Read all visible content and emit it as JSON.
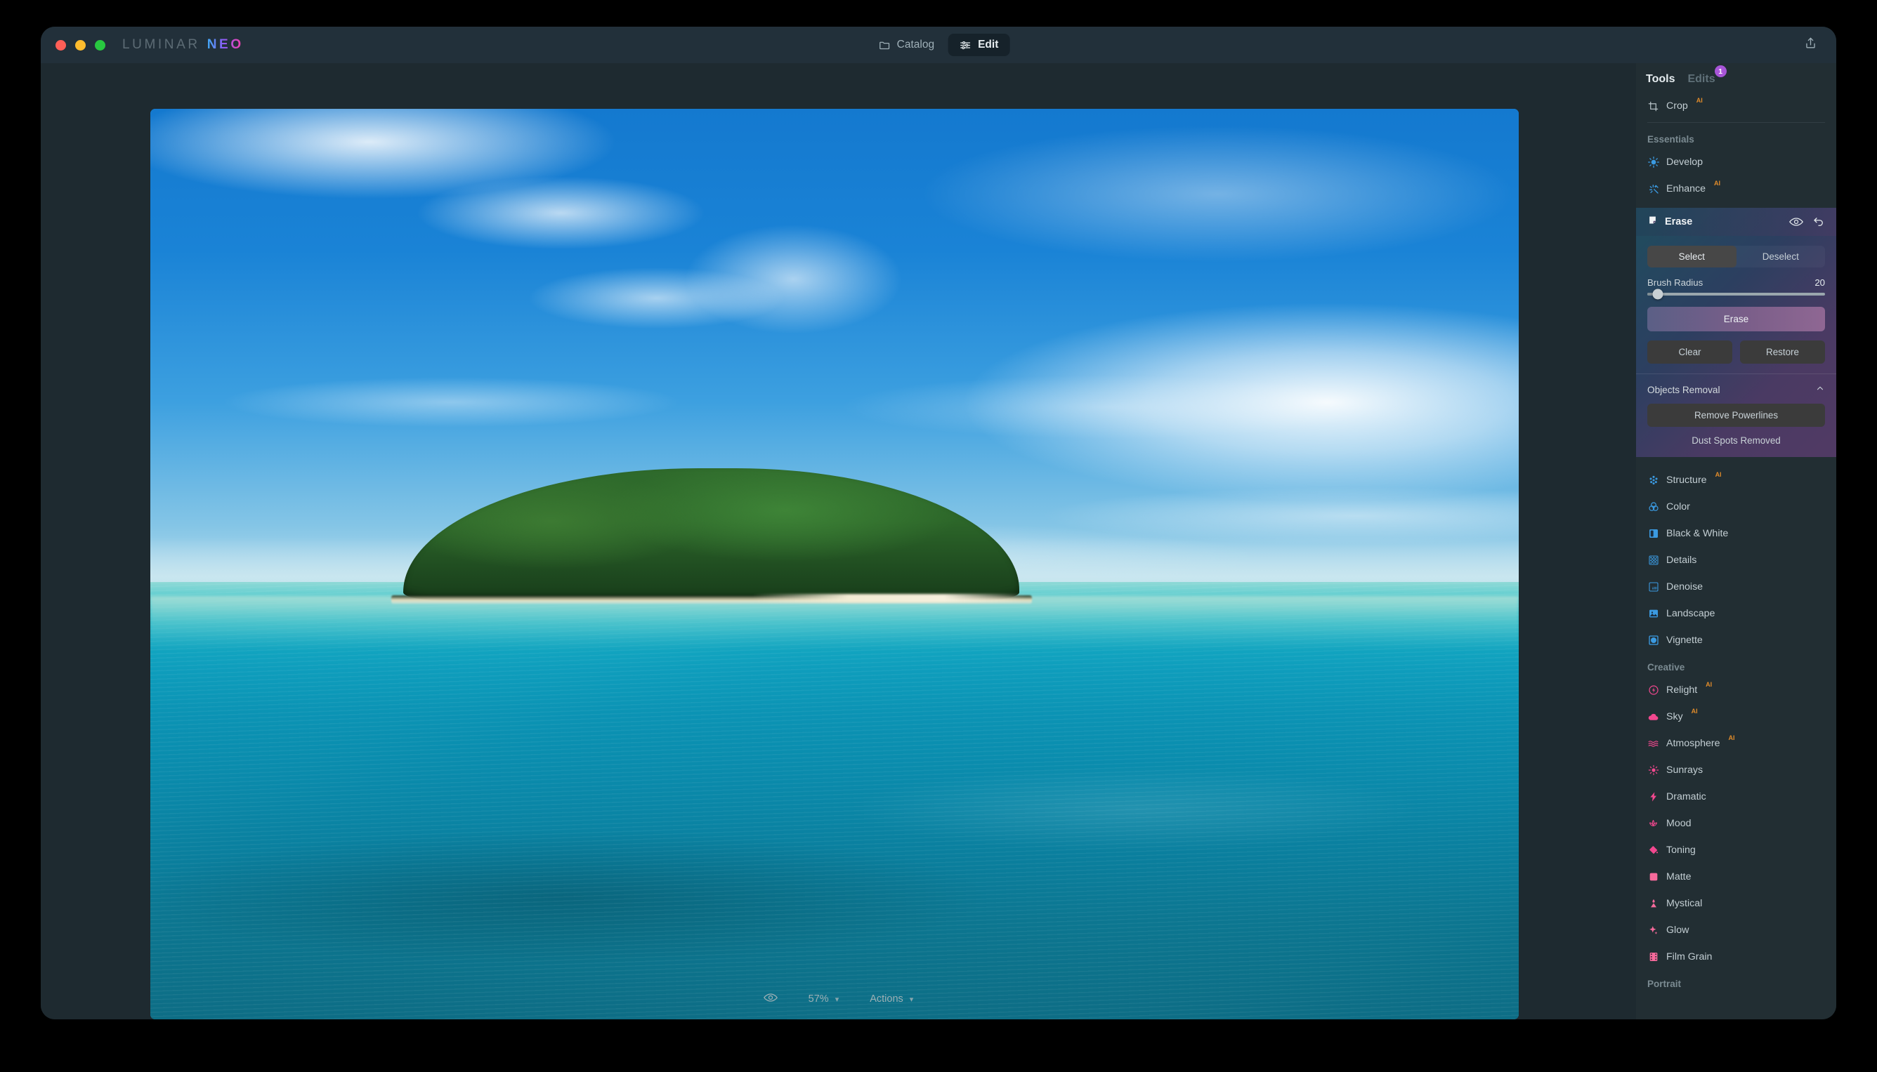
{
  "app": {
    "brand_primary": "LUMINAR",
    "brand_accent": "NEO",
    "accent_colors": {
      "purple": "#a855d8",
      "ai_orange": "#e08b2a",
      "blue_icon": "#3b9ae1",
      "pink_icon": "#f2488f"
    }
  },
  "titlebar": {
    "catalog_label": "Catalog",
    "edit_label": "Edit",
    "share_icon": "share-upload-icon"
  },
  "canvas": {
    "zoom_level": "57%",
    "actions_label": "Actions",
    "preview_icon": "eye-icon",
    "photo_alt": "tropical island with turquoise sea and blue sky"
  },
  "panel": {
    "tabs": {
      "tools": "Tools",
      "edits": "Edits",
      "edits_badge": "1"
    },
    "crop": {
      "label": "Crop",
      "ai": "AI"
    },
    "sections": {
      "essentials": "Essentials",
      "creative": "Creative",
      "portrait": "Portrait"
    },
    "essentials_items": [
      {
        "label": "Develop",
        "ai": "",
        "icon": "develop-sun-icon"
      },
      {
        "label": "Enhance",
        "ai": "AI",
        "icon": "enhance-sparkle-icon"
      }
    ],
    "after_erase_items": [
      {
        "label": "Structure",
        "ai": "AI",
        "icon": "structure-dots-icon"
      },
      {
        "label": "Color",
        "ai": "",
        "icon": "color-circles-icon"
      },
      {
        "label": "Black & White",
        "ai": "",
        "icon": "black-white-icon"
      },
      {
        "label": "Details",
        "ai": "",
        "icon": "details-grid-icon"
      },
      {
        "label": "Denoise",
        "ai": "",
        "icon": "denoise-icon"
      },
      {
        "label": "Landscape",
        "ai": "",
        "icon": "landscape-photo-icon"
      },
      {
        "label": "Vignette",
        "ai": "",
        "icon": "vignette-icon"
      }
    ],
    "creative_items": [
      {
        "label": "Relight",
        "ai": "AI",
        "icon": "relight-bolt-icon"
      },
      {
        "label": "Sky",
        "ai": "AI",
        "icon": "sky-cloud-icon"
      },
      {
        "label": "Atmosphere",
        "ai": "AI",
        "icon": "atmosphere-waves-icon"
      },
      {
        "label": "Sunrays",
        "ai": "",
        "icon": "sunrays-icon"
      },
      {
        "label": "Dramatic",
        "ai": "",
        "icon": "dramatic-bolt-icon"
      },
      {
        "label": "Mood",
        "ai": "",
        "icon": "mood-lotus-icon"
      },
      {
        "label": "Toning",
        "ai": "",
        "icon": "toning-bucket-icon"
      },
      {
        "label": "Matte",
        "ai": "",
        "icon": "matte-square-icon"
      },
      {
        "label": "Mystical",
        "ai": "",
        "icon": "mystical-candle-icon"
      },
      {
        "label": "Glow",
        "ai": "",
        "icon": "glow-sparkle-icon"
      },
      {
        "label": "Film Grain",
        "ai": "",
        "icon": "film-grain-icon"
      }
    ]
  },
  "erase": {
    "title": "Erase",
    "icon": "erase-eraser-icon",
    "visibility_icon": "eye-icon",
    "reset_icon": "undo-arrow-icon",
    "select_label": "Select",
    "deselect_label": "Deselect",
    "selected_mode": "Select",
    "brush_radius_label": "Brush Radius",
    "brush_radius_value": "20",
    "brush_radius_percent": 6,
    "erase_button": "Erase",
    "clear_button": "Clear",
    "restore_button": "Restore",
    "objects_removal_label": "Objects Removal",
    "objects_removal_collapse_icon": "chevron-up-icon",
    "remove_powerlines_button": "Remove Powerlines",
    "dust_spots_status": "Dust Spots Removed"
  }
}
